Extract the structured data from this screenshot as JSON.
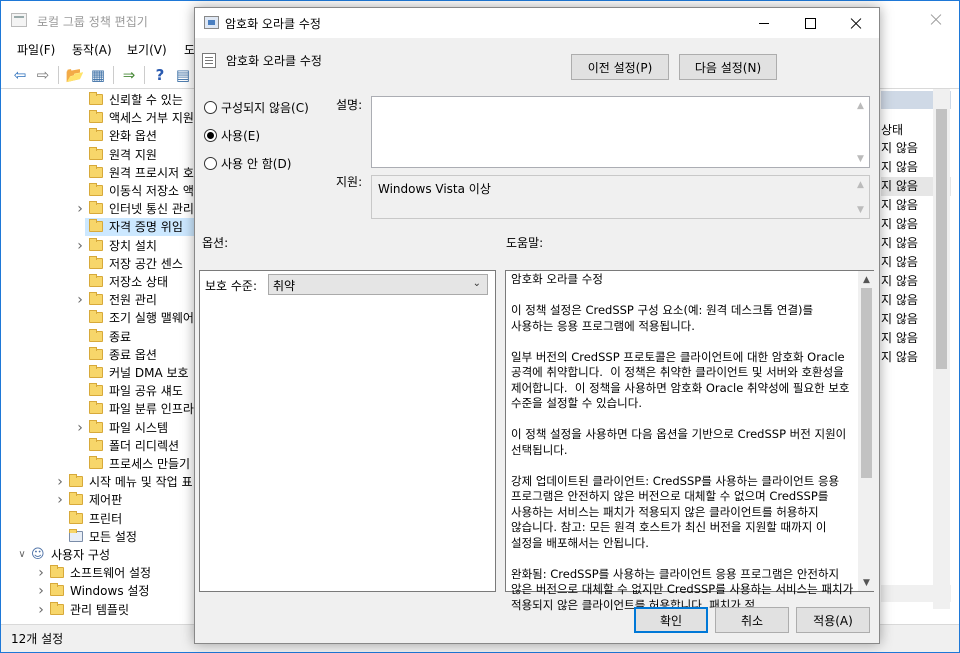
{
  "bg_window": {
    "title": "로컬 그룹 정책 편집기",
    "menus": [
      "파일(F)",
      "동작(A)",
      "보기(V)",
      "도"
    ],
    "tree": [
      {
        "label": "신뢰할 수 있는",
        "indent": 3,
        "expander": false,
        "icon": "folder"
      },
      {
        "label": "액세스 거부 지원",
        "indent": 3,
        "expander": false,
        "icon": "folder"
      },
      {
        "label": "완화 옵션",
        "indent": 3,
        "expander": false,
        "icon": "folder"
      },
      {
        "label": "원격 지원",
        "indent": 3,
        "expander": false,
        "icon": "folder"
      },
      {
        "label": "원격 프로시저 호",
        "indent": 3,
        "expander": false,
        "icon": "folder"
      },
      {
        "label": "이동식 저장소 액",
        "indent": 3,
        "expander": false,
        "icon": "folder"
      },
      {
        "label": "인터넷 통신 관리",
        "indent": 3,
        "expander": true,
        "icon": "folder"
      },
      {
        "label": "자격 증명 위임",
        "indent": 3,
        "expander": false,
        "icon": "folder",
        "selected": true
      },
      {
        "label": "장치 설치",
        "indent": 3,
        "expander": true,
        "icon": "folder"
      },
      {
        "label": "저장 공간 센스",
        "indent": 3,
        "expander": false,
        "icon": "folder"
      },
      {
        "label": "저장소 상태",
        "indent": 3,
        "expander": false,
        "icon": "folder"
      },
      {
        "label": "전원 관리",
        "indent": 3,
        "expander": true,
        "icon": "folder"
      },
      {
        "label": "조기 실행 맬웨어",
        "indent": 3,
        "expander": false,
        "icon": "folder"
      },
      {
        "label": "종료",
        "indent": 3,
        "expander": false,
        "icon": "folder"
      },
      {
        "label": "종료 옵션",
        "indent": 3,
        "expander": false,
        "icon": "folder"
      },
      {
        "label": "커널 DMA 보호",
        "indent": 3,
        "expander": false,
        "icon": "folder"
      },
      {
        "label": "파일 공유 섀도",
        "indent": 3,
        "expander": false,
        "icon": "folder"
      },
      {
        "label": "파일 분류 인프라",
        "indent": 3,
        "expander": false,
        "icon": "folder"
      },
      {
        "label": "파일 시스템",
        "indent": 3,
        "expander": true,
        "icon": "folder"
      },
      {
        "label": "폴더 리디렉션",
        "indent": 3,
        "expander": false,
        "icon": "folder"
      },
      {
        "label": "프로세스 만들기",
        "indent": 3,
        "expander": false,
        "icon": "folder"
      },
      {
        "label": "시작 메뉴 및 작업 표",
        "indent": 2,
        "expander": true,
        "icon": "folder"
      },
      {
        "label": "제어판",
        "indent": 2,
        "expander": true,
        "icon": "folder"
      },
      {
        "label": "프린터",
        "indent": 2,
        "expander": false,
        "icon": "folder"
      },
      {
        "label": "모든 설정",
        "indent": 2,
        "expander": false,
        "icon": "settings"
      },
      {
        "label": "사용자 구성",
        "indent": 0,
        "expander": "open",
        "icon": "user"
      },
      {
        "label": "소프트웨어 설정",
        "indent": 1,
        "expander": true,
        "icon": "folder"
      },
      {
        "label": "Windows 설정",
        "indent": 1,
        "expander": true,
        "icon": "folder"
      },
      {
        "label": "관리 템플릿",
        "indent": 1,
        "expander": true,
        "icon": "folder"
      }
    ],
    "right_column_header": "상태",
    "right_column_items": [
      "지 않음",
      "지 않음",
      "지 않음",
      "지 않음",
      "지 않음",
      "지 않음",
      "지 않음",
      "지 않음",
      "지 않음",
      "지 않음",
      "지 않음",
      "지 않음"
    ],
    "status": "12개 설정"
  },
  "dialog": {
    "title": "암호화 오라클 수정",
    "header_title": "암호화 오라클 수정",
    "prev_button": "이전 설정(P)",
    "next_button": "다음 설정(N)",
    "radios": [
      {
        "label": "구성되지 않음(C)",
        "checked": false
      },
      {
        "label": "사용(E)",
        "checked": true
      },
      {
        "label": "사용 안 함(D)",
        "checked": false
      }
    ],
    "comment_label": "설명:",
    "comment_value": "",
    "supported_label": "지원:",
    "supported_value": "Windows Vista 이상",
    "options_label": "옵션:",
    "help_label": "도움말:",
    "protection_label": "보호 수준:",
    "protection_value": "취약",
    "help_text": "암호화 오라클 수정\n\n이 정책 설정은 CredSSP 구성 요소(예: 원격 데스크톱 연결)를 사용하는 응용 프로그램에 적용됩니다.\n\n일부 버전의 CredSSP 프로토콜은 클라이언트에 대한 암호화 Oracle 공격에 취약합니다.  이 정책은 취약한 클라이언트 및 서버와 호환성을 제어합니다.  이 정책을 사용하면 암호화 Oracle 취약성에 필요한 보호 수준을 설정할 수 있습니다.\n\n이 정책 설정을 사용하면 다음 옵션을 기반으로 CredSSP 버전 지원이 선택됩니다.\n\n강제 업데이트된 클라이언트: CredSSP를 사용하는 클라이언트 응용 프로그램은 안전하지 않은 버전으로 대체할 수 없으며 CredSSP를 사용하는 서비스는 패치가 적용되지 않은 클라이언트를 허용하지 않습니다. 참고: 모든 원격 호스트가 최신 버전을 지원할 때까지 이 설정을 배포해서는 안됩니다.\n\n완화됨: CredSSP를 사용하는 클라이언트 응용 프로그램은 안전하지 않은 버전으로 대체할 수 없지만 CredSSP를 사용하는 서비스는 패치가 적용되지 않은 클라이언트를 허용합니다. 패치가 적",
    "ok_button": "확인",
    "cancel_button": "취소",
    "apply_button": "적용(A)"
  },
  "colors": {
    "accent": "#0078d7",
    "dialog_bg": "#f0f0f0",
    "selection": "#cce8ff"
  }
}
